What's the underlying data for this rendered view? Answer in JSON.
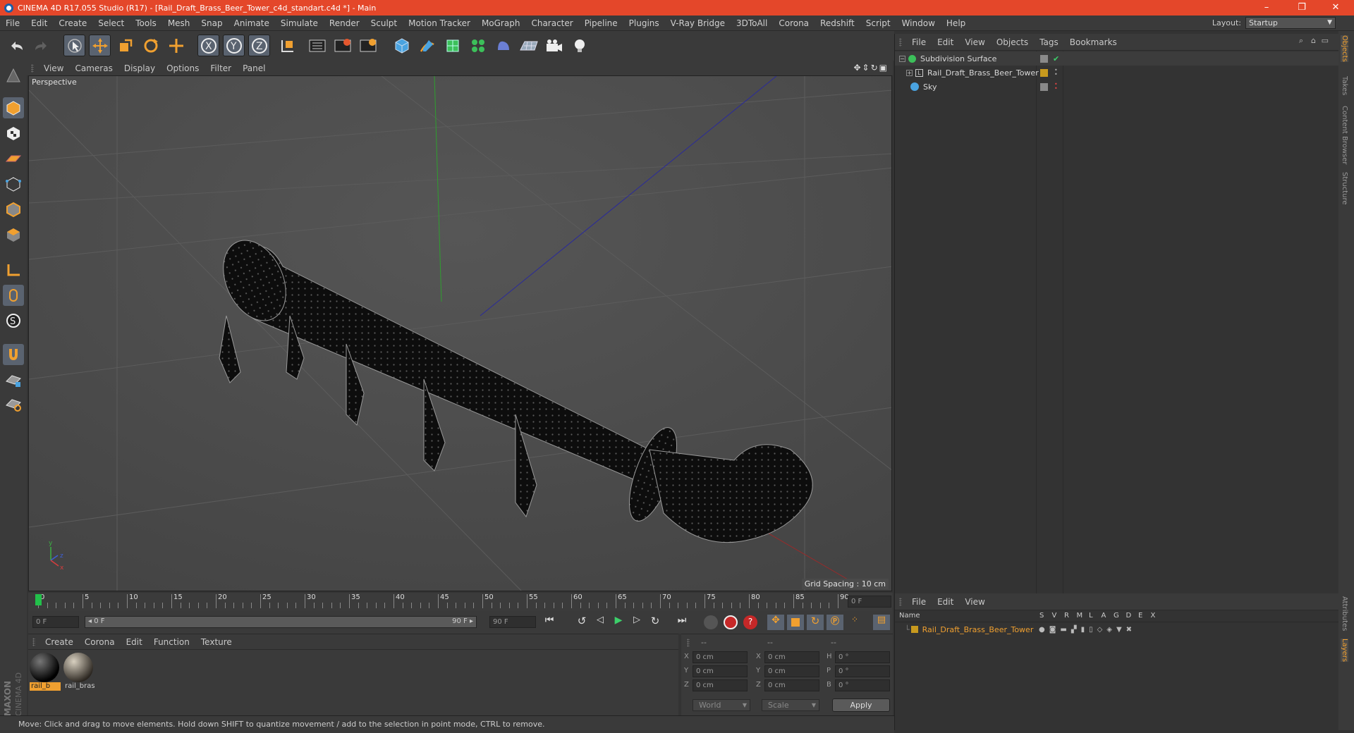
{
  "window": {
    "title": "CINEMA 4D R17.055 Studio (R17) - [Rail_Draft_Brass_Beer_Tower_c4d_standart.c4d *] - Main",
    "controls": [
      "–",
      "❐",
      "✕"
    ]
  },
  "menubar": {
    "items": [
      "File",
      "Edit",
      "Create",
      "Select",
      "Tools",
      "Mesh",
      "Snap",
      "Animate",
      "Simulate",
      "Render",
      "Sculpt",
      "Motion Tracker",
      "MoGraph",
      "Character",
      "Pipeline",
      "Plugins",
      "V-Ray Bridge",
      "3DToAll",
      "Corona",
      "Redshift",
      "Script",
      "Window",
      "Help"
    ],
    "layout_label": "Layout:",
    "layout_value": "Startup"
  },
  "toolbar": {
    "icons": [
      "undo-icon",
      "redo-icon",
      "select-icon",
      "move-icon",
      "scale-icon",
      "rotate-icon",
      "transform-icon",
      "x-axis-icon",
      "y-axis-icon",
      "z-axis-icon",
      "coord-system-icon",
      "render-view-icon",
      "render-picture-queue-icon",
      "render-settings-icon",
      "cube-icon",
      "pen-icon",
      "subdivision-icon",
      "cloner-icon",
      "deformer-icon",
      "floor-icon",
      "camera-icon",
      "light-icon"
    ],
    "axis_labels": {
      "x": "X",
      "y": "Y",
      "z": "Z"
    }
  },
  "viewport": {
    "menu": [
      "View",
      "Cameras",
      "Display",
      "Options",
      "Filter",
      "Panel"
    ],
    "label": "Perspective",
    "grid_spacing": "Grid Spacing : 10 cm",
    "axis_labels": {
      "x": "x",
      "y": "y",
      "z": "z"
    }
  },
  "timeline": {
    "ticks": [
      "0",
      "5",
      "10",
      "15",
      "20",
      "25",
      "30",
      "35",
      "40",
      "45",
      "50",
      "55",
      "60",
      "65",
      "70",
      "75",
      "80",
      "85",
      "90"
    ],
    "current_frame": "0 F",
    "start_field": "0 F",
    "range_start": "◂ 0 F",
    "range_end": "90 F ▸",
    "end_field": "90 F"
  },
  "materials": {
    "menu": [
      "Create",
      "Corona",
      "Edit",
      "Function",
      "Texture"
    ],
    "items": [
      {
        "name": "rail_b"
      },
      {
        "name": "rail_bras"
      }
    ]
  },
  "coords": {
    "headers": [
      "--",
      "--",
      "--"
    ],
    "rows": [
      {
        "a": "X",
        "av": "0 cm",
        "b": "X",
        "bv": "0 cm",
        "c": "H",
        "cv": "0 °"
      },
      {
        "a": "Y",
        "av": "0 cm",
        "b": "Y",
        "bv": "0 cm",
        "c": "P",
        "cv": "0 °"
      },
      {
        "a": "Z",
        "av": "0 cm",
        "b": "Z",
        "bv": "0 cm",
        "c": "B",
        "cv": "0 °"
      }
    ],
    "mode1": "World",
    "mode2": "Scale",
    "apply": "Apply"
  },
  "object_manager": {
    "menu": [
      "File",
      "Edit",
      "View",
      "Objects",
      "Tags",
      "Bookmarks"
    ],
    "objects": [
      {
        "name": "Subdivision Surface"
      },
      {
        "name": "Rail_Draft_Brass_Beer_Tower"
      },
      {
        "name": "Sky"
      }
    ]
  },
  "layer_manager": {
    "menu": [
      "File",
      "Edit",
      "View"
    ],
    "columns": [
      "Name",
      "S",
      "V",
      "R",
      "M",
      "L",
      "A",
      "G",
      "D",
      "E",
      "X"
    ],
    "layers": [
      {
        "name": "Rail_Draft_Brass_Beer_Tower",
        "color": "#c89a1e"
      }
    ]
  },
  "right_tabs": [
    "Objects",
    "Takes",
    "Content Browser",
    "Structure",
    "Attributes",
    "Layers"
  ],
  "branding": {
    "maxon": "MAXON",
    "product": "CINEMA 4D"
  },
  "status": "Move: Click and drag to move elements. Hold down SHIFT to quantize movement / add to the selection in point mode, CTRL to remove.",
  "colors": {
    "titlebar": "#e4472a",
    "accent_orange": "#f0a030",
    "highlight_blue": "#5a6370"
  }
}
